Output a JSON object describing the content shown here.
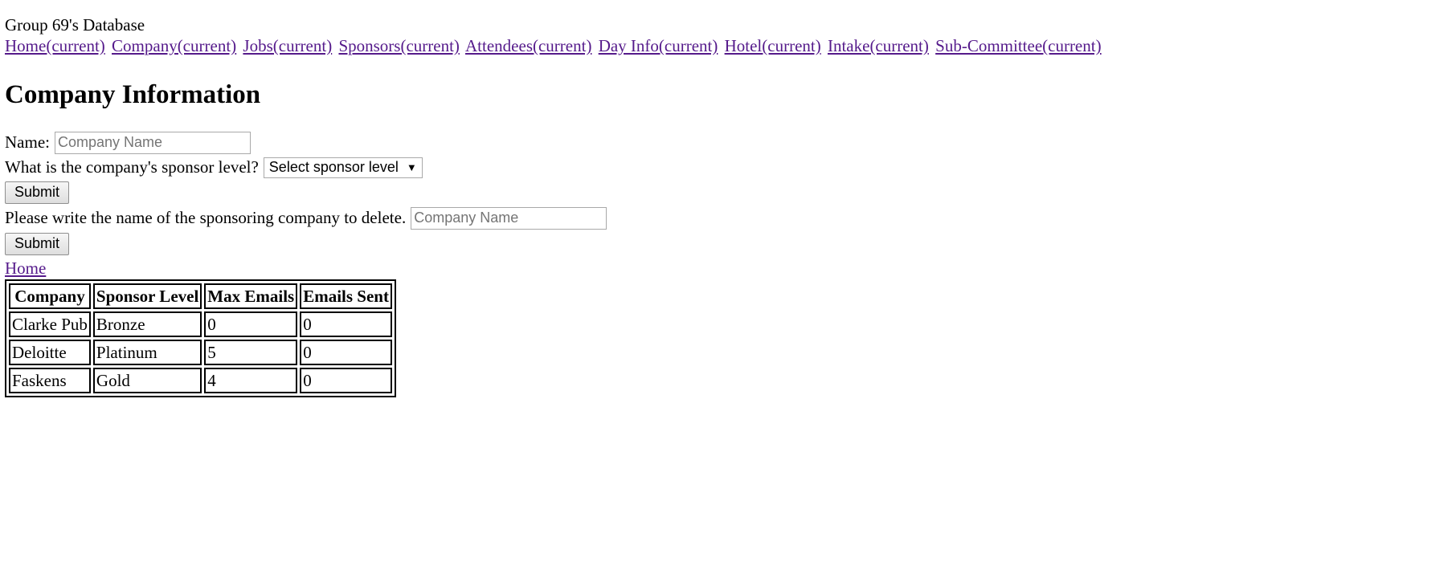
{
  "header": {
    "site_title": "Group 69's Database"
  },
  "nav": {
    "items": [
      {
        "label": "Home(current)"
      },
      {
        "label": "Company(current)"
      },
      {
        "label": "Jobs(current)"
      },
      {
        "label": "Sponsors(current)"
      },
      {
        "label": "Attendees(current)"
      },
      {
        "label": "Day Info(current)"
      },
      {
        "label": "Hotel(current)"
      },
      {
        "label": "Intake(current)"
      },
      {
        "label": "Sub-Committee(current)"
      }
    ]
  },
  "main": {
    "title": "Company Information",
    "add_form": {
      "name_label": "Name:",
      "name_placeholder": "Company Name",
      "name_value": "",
      "sponsor_question": "What is the company's sponsor level?",
      "sponsor_select_value": "Select sponsor level",
      "submit_label": "Submit"
    },
    "delete_form": {
      "prompt": "Please write the name of the sponsoring company to delete.",
      "placeholder": "Company Name",
      "value": "",
      "submit_label": "Submit"
    },
    "home_link": "Home",
    "table": {
      "headers": [
        "Company",
        "Sponsor Level",
        "Max Emails",
        "Emails Sent"
      ],
      "rows": [
        [
          "Clarke Pub",
          "Bronze",
          "0",
          "0"
        ],
        [
          "Deloitte",
          "Platinum",
          "5",
          "0"
        ],
        [
          "Faskens",
          "Gold",
          "4",
          "0"
        ]
      ]
    }
  },
  "icons": {
    "select_caret": "chevron-down-icon"
  },
  "colors": {
    "link": "#551a8b",
    "text": "#000000",
    "background": "#ffffff"
  }
}
